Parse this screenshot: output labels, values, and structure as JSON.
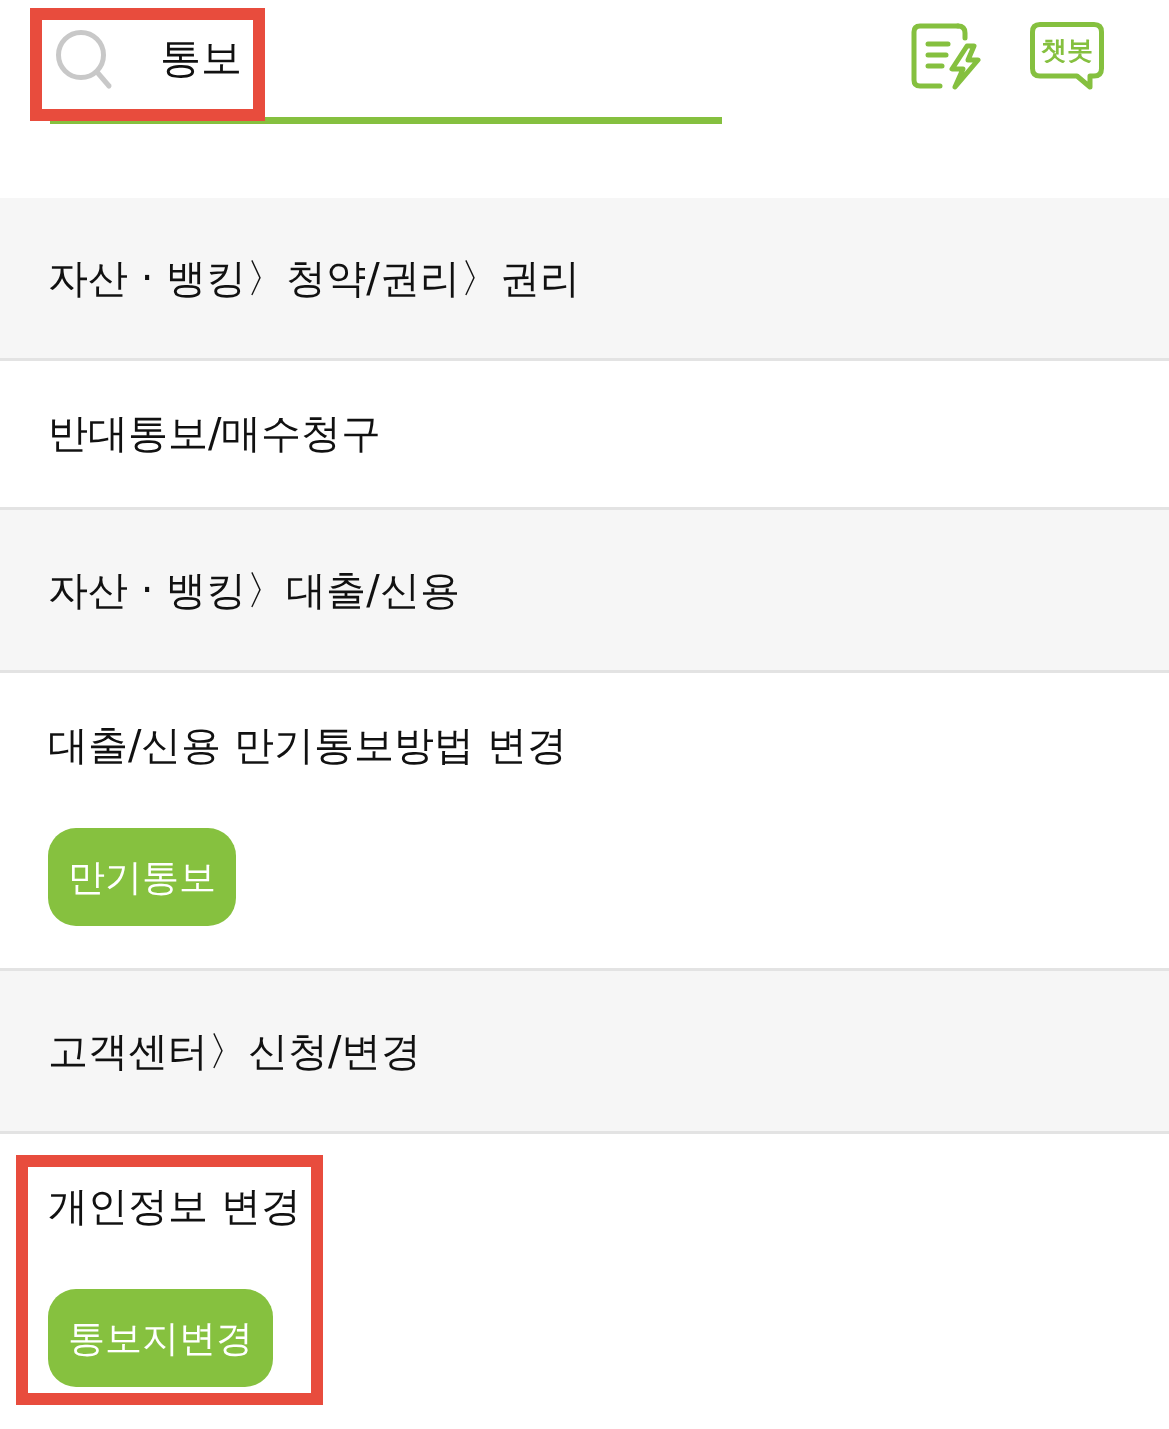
{
  "header": {
    "search": {
      "value": "통보",
      "highlighted": true
    },
    "chatbot_label": "챗봇"
  },
  "results": [
    {
      "kind": "category",
      "path": "자산 · 뱅킹〉청약/권리〉권리",
      "highlighted": false
    },
    {
      "kind": "item",
      "title": "반대통보/매수청구",
      "highlighted": false
    },
    {
      "kind": "category",
      "path": "자산 · 뱅킹〉대출/신용",
      "highlighted": false
    },
    {
      "kind": "item",
      "title": "대출/신용 만기통보방법 변경",
      "tags": [
        "만기통보"
      ],
      "highlighted": false
    },
    {
      "kind": "category",
      "path": "고객센터〉신청/변경",
      "highlighted": false
    },
    {
      "kind": "item",
      "title": "개인정보 변경",
      "tags": [
        "통보지변경"
      ],
      "highlighted": true
    }
  ]
}
